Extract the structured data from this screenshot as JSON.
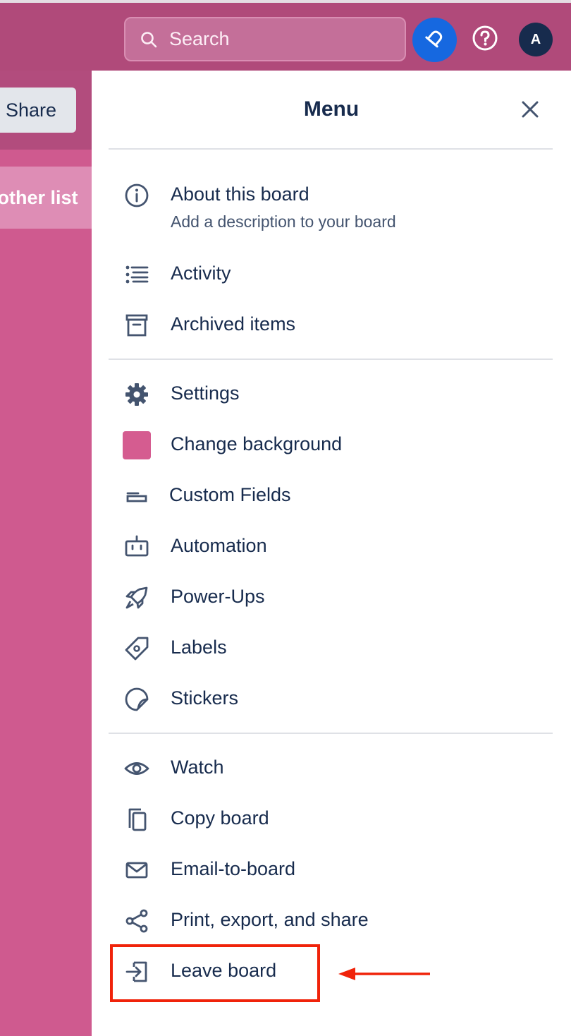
{
  "topbar": {
    "search_placeholder": "Search",
    "avatar_initial": "A",
    "icons": [
      "search-icon",
      "notifications-icon",
      "help-icon"
    ]
  },
  "board": {
    "share_label": "Share",
    "add_list_label": "nother list"
  },
  "menu": {
    "title": "Menu",
    "sections": [
      [
        {
          "label": "About this board",
          "sub": "Add a description to your board",
          "icon": "info-icon"
        },
        {
          "label": "Activity",
          "icon": "activity-list-icon"
        },
        {
          "label": "Archived items",
          "icon": "archive-icon"
        }
      ],
      [
        {
          "label": "Settings",
          "icon": "gear-icon"
        },
        {
          "label": "Change background",
          "icon": "background-swatch"
        },
        {
          "label": "Custom Fields",
          "icon": "custom-fields-icon"
        },
        {
          "label": "Automation",
          "icon": "automation-icon"
        },
        {
          "label": "Power-Ups",
          "icon": "rocket-icon"
        },
        {
          "label": "Labels",
          "icon": "label-tag-icon"
        },
        {
          "label": "Stickers",
          "icon": "sticker-icon"
        }
      ],
      [
        {
          "label": "Watch",
          "icon": "eye-icon"
        },
        {
          "label": "Copy board",
          "icon": "copy-icon"
        },
        {
          "label": "Email-to-board",
          "icon": "email-icon"
        },
        {
          "label": "Print, export, and share",
          "icon": "share-icon"
        },
        {
          "label": "Leave board",
          "icon": "leave-icon"
        }
      ]
    ]
  },
  "colors": {
    "board_background": "#cf5a8f",
    "swatch": "#d55c90",
    "highlight": "#f0230a"
  }
}
